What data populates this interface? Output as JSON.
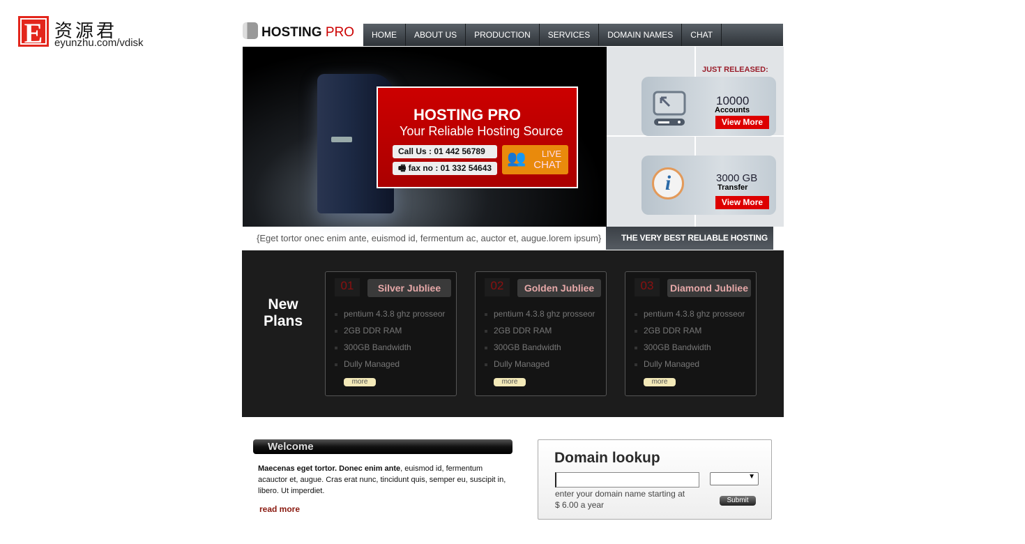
{
  "watermark": {
    "letter": "E",
    "chinese": "资源君",
    "url": "eyunzhu.com/vdisk"
  },
  "brand": {
    "name": "HOSTING",
    "suffix": "PRO"
  },
  "nav": [
    "HOME",
    "ABOUT US",
    "PRODUCTION",
    "SERVICES",
    "DOMAIN NAMES",
    "CHAT"
  ],
  "banner": {
    "title": "HOSTING PRO",
    "subtitle": "Your Reliable Hosting Source",
    "call": "Call Us : 01 442 56789",
    "fax": "fax no : 01 332 54643",
    "live": "LIVE",
    "chat": "CHAT"
  },
  "side": {
    "just_released": "JUST RELEASED:",
    "cards": [
      {
        "value": "10000",
        "label": "Accounts",
        "button": "View More"
      },
      {
        "value": "3000 GB",
        "label": "Transfer",
        "button": "View More"
      }
    ]
  },
  "tagline": "{Eget tortor onec enim ante, euismod id, fermentum ac, auctor et, augue.lorem ipsum}",
  "best": "THE VERY BEST RELIABLE HOSTING",
  "plans": {
    "title": "New Plans",
    "items": [
      {
        "num": "01",
        "name": "Silver Jubliee",
        "features": [
          "pentium 4.3.8 ghz prosseor",
          "2GB DDR RAM",
          "300GB Bandwidth",
          "Dully Managed"
        ],
        "more": "more"
      },
      {
        "num": "02",
        "name": "Golden Jubliee",
        "features": [
          "pentium 4.3.8 ghz prosseor",
          "2GB DDR RAM",
          "300GB Bandwidth",
          "Dully Managed"
        ],
        "more": "more"
      },
      {
        "num": "03",
        "name": "Diamond Jubliee",
        "features": [
          "pentium 4.3.8 ghz prosseor",
          "2GB DDR RAM",
          "300GB Bandwidth",
          "Dully Managed"
        ],
        "more": "more"
      }
    ]
  },
  "welcome": {
    "title": "Welcome",
    "bold": "Maecenas eget tortor. Donec enim ante",
    "text": ", euismod id, fermentum acauctor et, augue. Cras erat nunc, tincidunt quis, semper eu, suscipit in, libero. Ut imperdiet.",
    "read_more": "read more"
  },
  "domain": {
    "title": "Domain lookup",
    "input_value": "",
    "select_value": "",
    "hint": "enter your domain name starting at $ 6.00 a year",
    "submit": "Submit"
  }
}
